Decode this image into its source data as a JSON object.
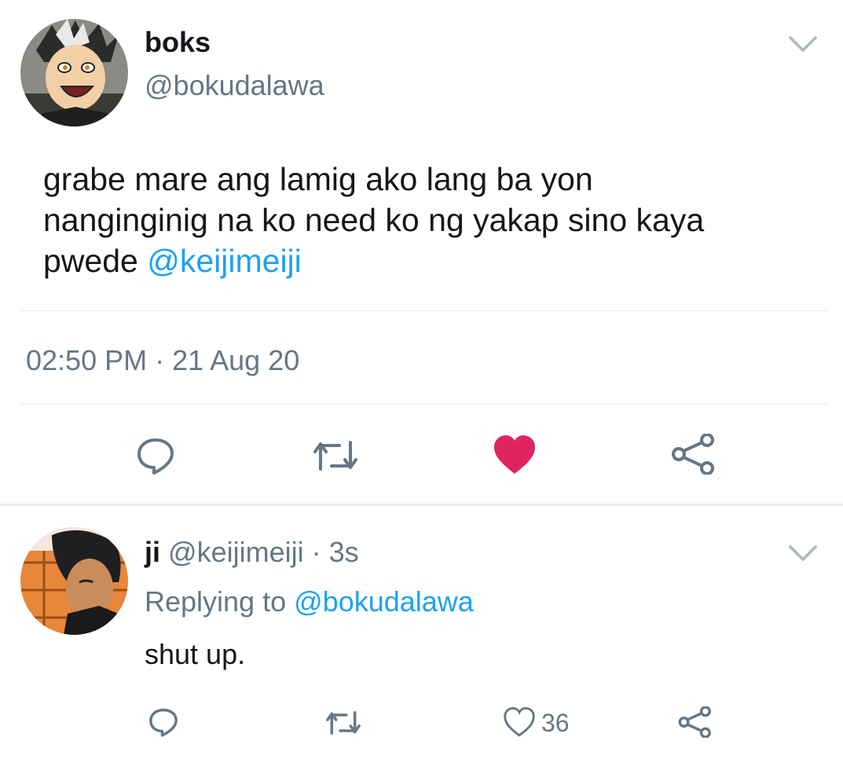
{
  "main_tweet": {
    "display_name": "boks",
    "handle": "@bokudalawa",
    "text_lines": [
      "grabe mare ang lamig ako lang ba yon",
      "nanginginig na ko need ko ng yakap sino kaya",
      "pwede"
    ],
    "mention": "@keijimeiji",
    "timestamp": "02:50 PM · 21 Aug 20",
    "liked": true,
    "icons": [
      "reply-icon",
      "retweet-icon",
      "heart-filled-icon",
      "share-icon"
    ]
  },
  "reply": {
    "display_name": "ji",
    "handle": "@keijimeiji",
    "time": "· 3s",
    "replying_prefix": "Replying to",
    "replying_to": "@bokudalawa",
    "text": "shut up.",
    "like_count": "36",
    "icons": [
      "reply-icon",
      "retweet-icon",
      "heart-outline-icon",
      "share-icon"
    ]
  },
  "colors": {
    "accent": "#1da1f2",
    "like": "#e0245e",
    "muted": "#657786",
    "divider": "#e6ecf0"
  }
}
